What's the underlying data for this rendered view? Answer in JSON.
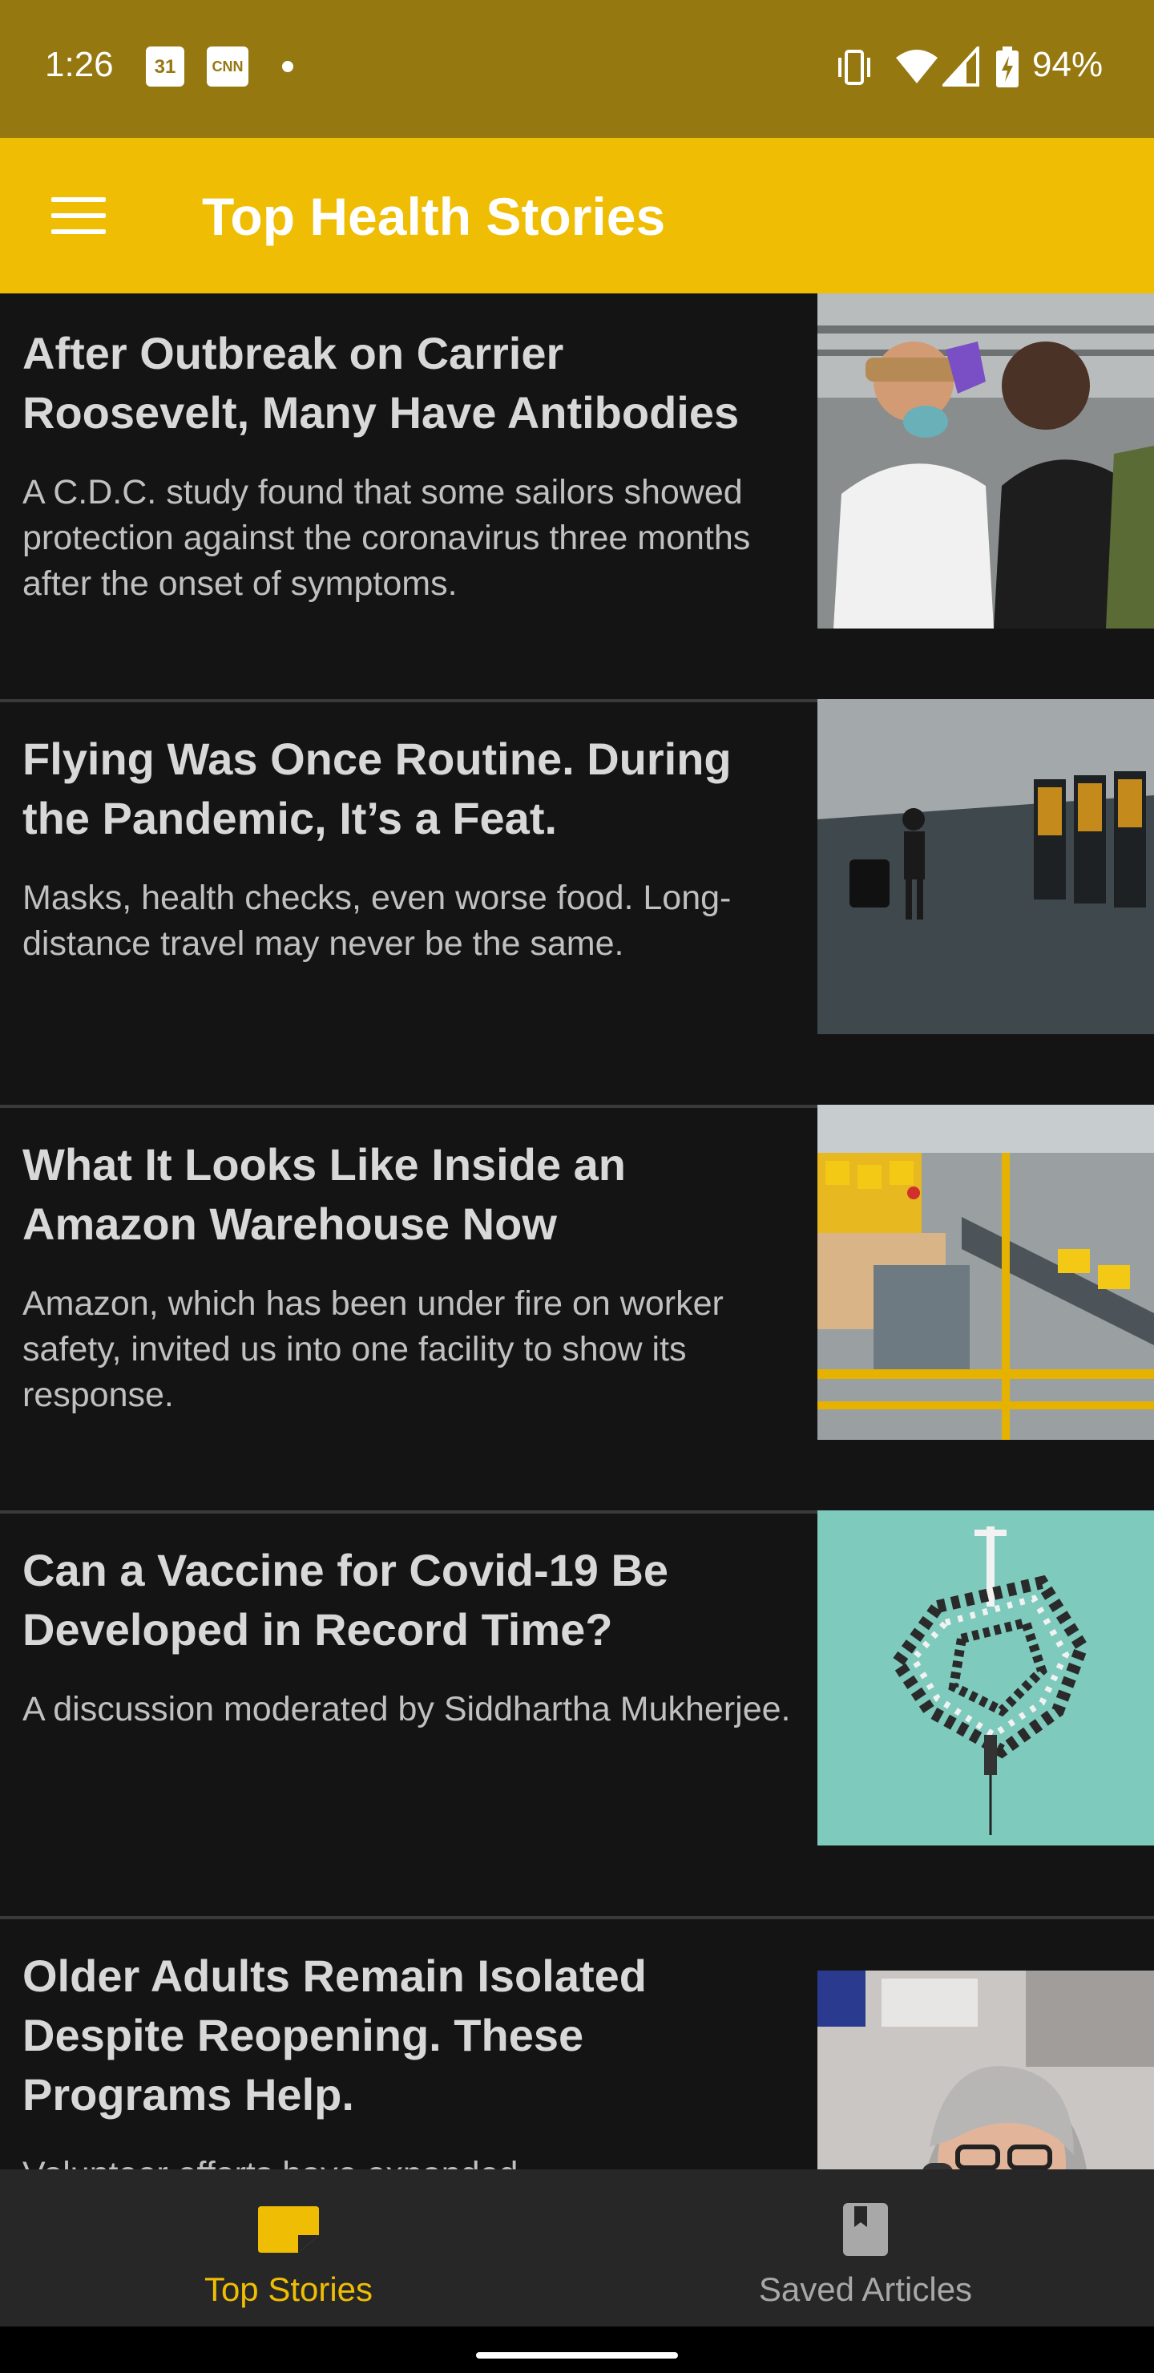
{
  "status_bar": {
    "time": "1:26",
    "calendar_day": "31",
    "cnn": "CNN",
    "battery": "94%",
    "icons": [
      "calendar-icon",
      "cnn-icon",
      "dot-icon",
      "vibrate-icon",
      "wifi-icon",
      "signal-icon",
      "battery-charging-icon"
    ]
  },
  "app_bar": {
    "title": "Top Health Stories",
    "menu_icon": "hamburger-menu-icon"
  },
  "articles": [
    {
      "title": "After Outbreak on Carrier Roosevelt, Many Have Antibodies",
      "summary": "A C.D.C. study found that some sailors showed protection against the coronavirus three months after the onset of symptoms."
    },
    {
      "title": "Flying Was Once Routine. During the Pandemic, It’s a Feat.",
      "summary": "Masks, health checks, even worse food. Long-distance travel may never be the same."
    },
    {
      "title": "What It Looks Like Inside an Amazon Warehouse Now",
      "summary": "Amazon, which has been under fire on worker safety, invited us into one facility to show its response."
    },
    {
      "title": "Can a Vaccine for Covid-19 Be Developed in Record Time?",
      "summary": "A discussion moderated by Siddhartha Mukherjee."
    },
    {
      "title": "Older Adults Remain Isolated Despite Reopening. These Programs Help.",
      "summary": "Volunteer efforts have expanded"
    }
  ],
  "bottom_nav": {
    "items": [
      {
        "label": "Top Stories",
        "icon": "top-stories-icon",
        "active": true
      },
      {
        "label": "Saved Articles",
        "icon": "saved-articles-icon",
        "active": false
      }
    ]
  },
  "colors": {
    "accent": "#efbd04",
    "status_bar": "#967811",
    "background": "#141414",
    "nav_background": "#272727"
  }
}
